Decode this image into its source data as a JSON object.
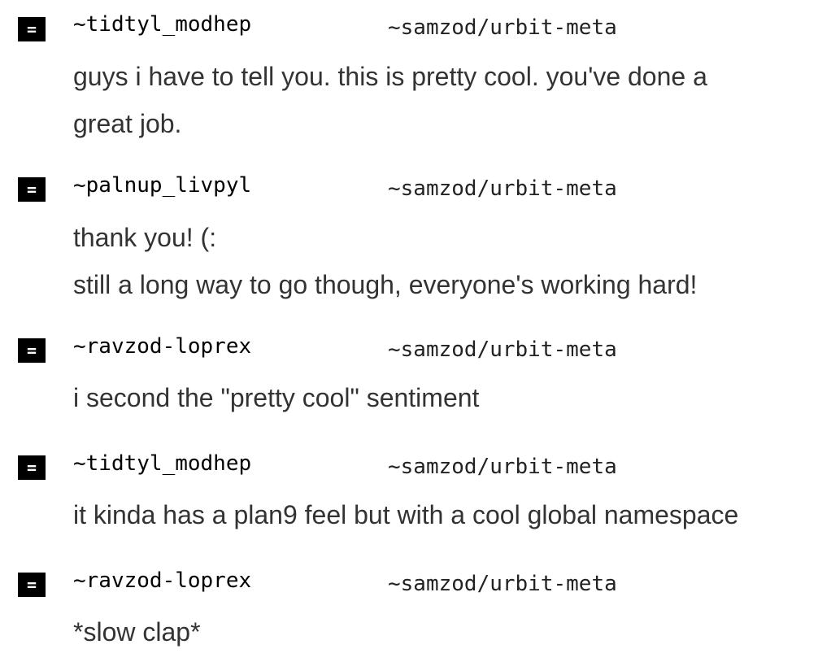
{
  "messages": [
    {
      "glyph": "=",
      "author": "~tidtyl_modhep",
      "channel": "~samzod/urbit-meta",
      "lines": [
        "guys i have to tell you. this is pretty cool. you've done a",
        "great job."
      ]
    },
    {
      "glyph": "=",
      "author": "~palnup_livpyl",
      "channel": "~samzod/urbit-meta",
      "lines": [
        "thank you! (:",
        "still a long way to go though, everyone's working hard!"
      ]
    },
    {
      "glyph": "=",
      "author": "~ravzod-loprex",
      "channel": "~samzod/urbit-meta",
      "lines": [
        "i second the \"pretty cool\" sentiment"
      ]
    },
    {
      "glyph": "=",
      "author": "~tidtyl_modhep",
      "channel": "~samzod/urbit-meta",
      "lines": [
        "it kinda has a plan9 feel but with a cool global namespace"
      ]
    },
    {
      "glyph": "=",
      "author": "~ravzod-loprex",
      "channel": "~samzod/urbit-meta",
      "lines": [
        "*slow clap*"
      ]
    }
  ]
}
